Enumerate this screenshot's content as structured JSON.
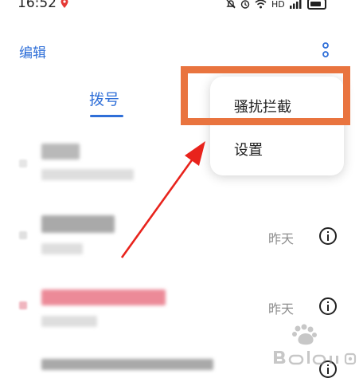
{
  "status_bar": {
    "time": "16:52",
    "network_badge": "HD"
  },
  "header": {
    "edit_label": "编辑"
  },
  "tabs": [
    {
      "label": "拨号",
      "active": true
    }
  ],
  "popup_menu": {
    "items": [
      {
        "label": "骚扰拦截"
      },
      {
        "label": "设置"
      }
    ]
  },
  "call_log": [
    {
      "time": ""
    },
    {
      "time": "昨天"
    },
    {
      "time": "昨天"
    },
    {
      "time": ""
    }
  ],
  "colors": {
    "accent": "#2f6fd8",
    "highlight": "#e9743f",
    "arrow": "#e8231c",
    "missed": "#e0485a"
  },
  "icons": [
    "location-pin-icon",
    "silent-icon",
    "alarm-icon",
    "wifi-icon",
    "signal-icon",
    "battery-icon",
    "more-vertical-icon",
    "info-icon"
  ]
}
